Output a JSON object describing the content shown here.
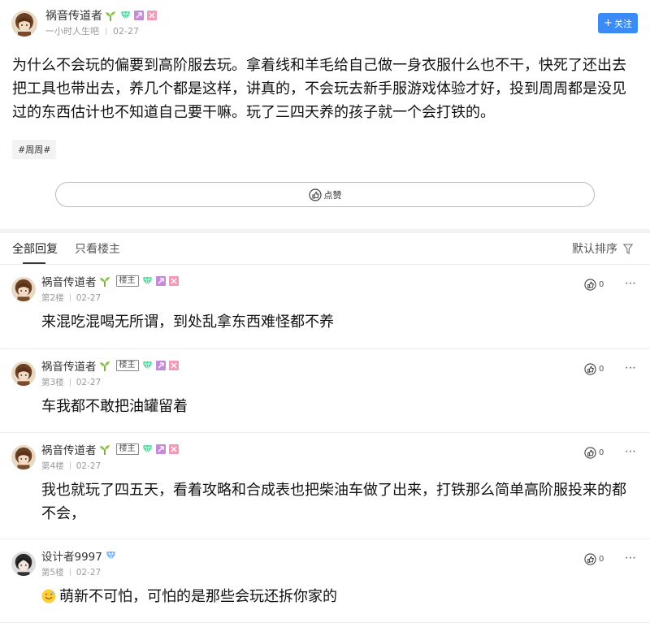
{
  "post": {
    "author": "祸音传道者",
    "subtitle": "一小时人生吧",
    "date": "02-27",
    "follow_label": "关注",
    "body": "为什么不会玩的偏要到高阶服去玩。拿着线和羊毛给自己做一身衣服什么也不干，快死了还出去把工具也带出去，养几个都是这样，讲真的，不会玩去新手服游戏体验才好，投到周周都是没见过的东西估计也不知道自己要干嘛。玩了三四天养的孩子就一个会打铁的。",
    "tag": "#周周#",
    "like_label": "点赞"
  },
  "tabs": {
    "all": "全部回复",
    "owner_only": "只看楼主",
    "sort": "默认排序"
  },
  "comments": [
    {
      "author": "祸音传道者",
      "owner_badge": "楼主",
      "floor": "第2楼",
      "date": "02-27",
      "likes": "0",
      "text": "来混吃混喝无所谓，到处乱拿东西难怪都不养"
    },
    {
      "author": "祸音传道者",
      "owner_badge": "楼主",
      "floor": "第3楼",
      "date": "02-27",
      "likes": "0",
      "text": "车我都不敢把油罐留着"
    },
    {
      "author": "祸音传道者",
      "owner_badge": "楼主",
      "floor": "第4楼",
      "date": "02-27",
      "likes": "0",
      "text": "我也就玩了四五天，看着攻略和合成表也把柴油车做了出来，打铁那么简单高阶服投来的都不会，"
    },
    {
      "author": "设计者9997",
      "owner_badge": "",
      "floor": "第5楼",
      "date": "02-27",
      "likes": "0",
      "text": "萌新不可怕，可怕的是那些会玩还拆你家的"
    }
  ],
  "icons": {
    "sprout": "sprout-icon",
    "gem_green": "gem-green-icon",
    "gem_blue": "gem-blue-icon",
    "like": "thumbs-up-icon",
    "more": "more-dots-icon",
    "filter": "filter-icon"
  },
  "colors": {
    "accent": "#3a8bf5",
    "gem_green": "#4cd69a",
    "badge_pink": "#f29ab8",
    "gem_blue": "#6ab0ff"
  }
}
